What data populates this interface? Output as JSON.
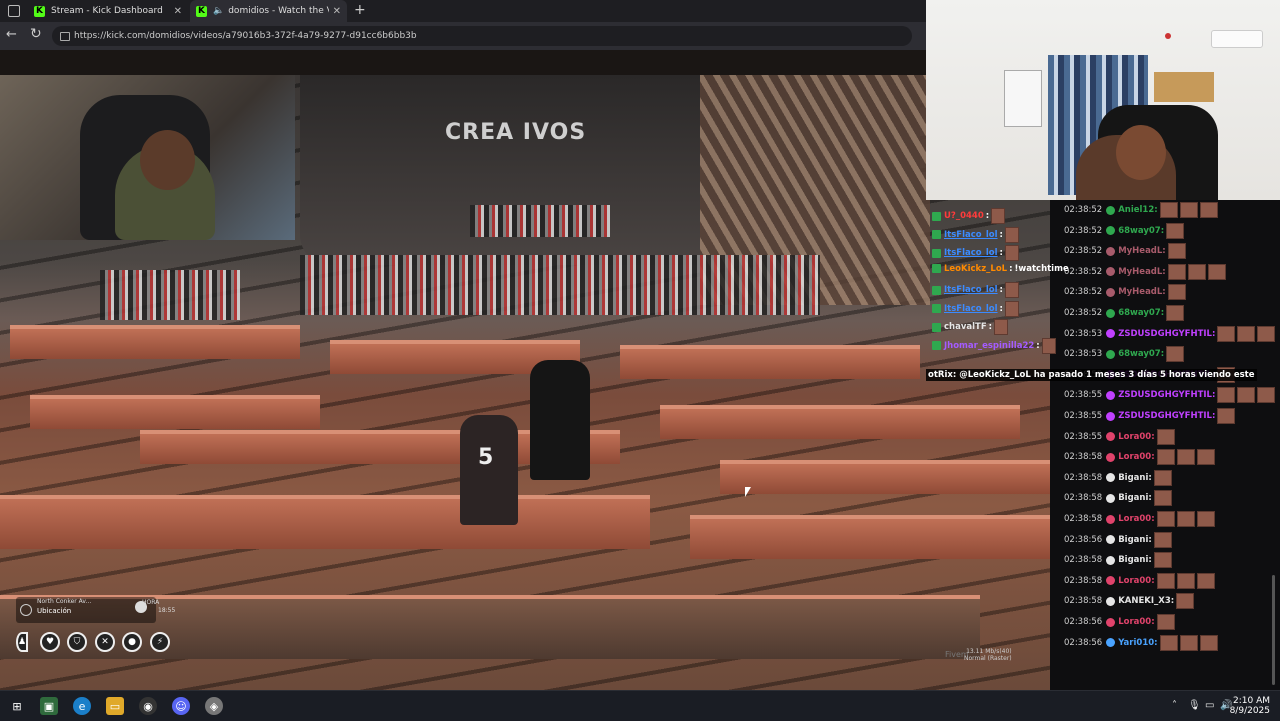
{
  "browser": {
    "tabs": [
      {
        "title": "Stream - Kick Dashboard",
        "favicon": "K"
      },
      {
        "title": "domidios - Watch the VOD o",
        "favicon": "K"
      }
    ],
    "url": "https://kick.com/domidios/videos/a79016b3-372f-4a79-9277-d91cc6b6bb3b",
    "accent": "#53fc18"
  },
  "game": {
    "sign": "CREA IVOS",
    "jersey_number": "5",
    "hud": {
      "street": "North Conker Av...",
      "location_label": "Ubicación",
      "hora_label": "HORA",
      "time": "18:55",
      "perf_line1": "13.11 Mb/s(40)",
      "perf_line2": "Normal (Raster)",
      "fps_text": "Fivem"
    },
    "status_icons": [
      "person-icon",
      "heart-icon",
      "shield-icon",
      "food-icon",
      "water-icon",
      "stamina-icon"
    ]
  },
  "chat": {
    "overlay_left": [
      {
        "user": "U?_0440",
        "color": "#ff3b3b"
      },
      {
        "user": "ItsFlaco_lol",
        "color": "#3b8bff"
      },
      {
        "user": "ItsFlaco_lol",
        "color": "#3b8bff"
      },
      {
        "user": "LeoKickz_LoL",
        "color": "#ff8a00",
        "text": "!watchtime"
      },
      {
        "user": "ItsFlaco_lol",
        "color": "#3b8bff"
      },
      {
        "user": "ItsFlaco_lol",
        "color": "#3b8bff"
      },
      {
        "user": "chavalTF",
        "color": "#e6e6e6"
      },
      {
        "user": "Jhomar_espinilla22",
        "color": "#a45cff"
      }
    ],
    "system_prefix": "otRix",
    "system_msg": ": @LeoKickz_LoL ha pasado 1 meses 3 días 5 horas viendo este",
    "messages": [
      {
        "ts": "02:38:52",
        "user": "Aniel12:",
        "color": "#2fa84f"
      },
      {
        "ts": "02:38:52",
        "user": "68way07:",
        "color": "#2fa84f"
      },
      {
        "ts": "02:38:52",
        "user": "MyHeadL:",
        "color": "#a85b6b"
      },
      {
        "ts": "02:38:52",
        "user": "MyHeadL:",
        "color": "#a85b6b"
      },
      {
        "ts": "02:38:52",
        "user": "MyHeadL:",
        "color": "#a85b6b"
      },
      {
        "ts": "02:38:52",
        "user": "68way07:",
        "color": "#2fa84f"
      },
      {
        "ts": "02:38:53",
        "user": "ZSDUSDGHGYFHTIL:",
        "color": "#c040ff"
      },
      {
        "ts": "02:38:53",
        "user": "68way07:",
        "color": "#2fa84f"
      },
      {
        "ts": "02:38:55",
        "user": "ZSDUSDGHGYFHTIL:",
        "color": "#c040ff"
      },
      {
        "ts": "02:38:55",
        "user": "ZSDUSDGHGYFHTIL:",
        "color": "#c040ff"
      },
      {
        "ts": "02:38:55",
        "user": "ZSDUSDGHGYFHTIL:",
        "color": "#c040ff"
      },
      {
        "ts": "02:38:55",
        "user": "Lora00:",
        "color": "#e0436b"
      },
      {
        "ts": "02:38:58",
        "user": "Lora00:",
        "color": "#e0436b"
      },
      {
        "ts": "02:38:58",
        "user": "Bigani:",
        "color": "#e6e6e6"
      },
      {
        "ts": "02:38:58",
        "user": "Bigani:",
        "color": "#e6e6e6"
      },
      {
        "ts": "02:38:58",
        "user": "Lora00:",
        "color": "#e0436b"
      },
      {
        "ts": "02:38:56",
        "user": "Bigani:",
        "color": "#e6e6e6"
      },
      {
        "ts": "02:38:58",
        "user": "Bigani:",
        "color": "#e6e6e6"
      },
      {
        "ts": "02:38:58",
        "user": "Lora00:",
        "color": "#e0436b"
      },
      {
        "ts": "02:38:58",
        "user": "KANEKI_X3:",
        "color": "#e6e6e6"
      },
      {
        "ts": "02:38:56",
        "user": "Lora00:",
        "color": "#e0436b"
      },
      {
        "ts": "02:38:56",
        "user": "Yari010:",
        "color": "#4aa3ff"
      }
    ]
  },
  "taskbar": {
    "time": "2:10 AM",
    "date": "8/9/2025"
  }
}
